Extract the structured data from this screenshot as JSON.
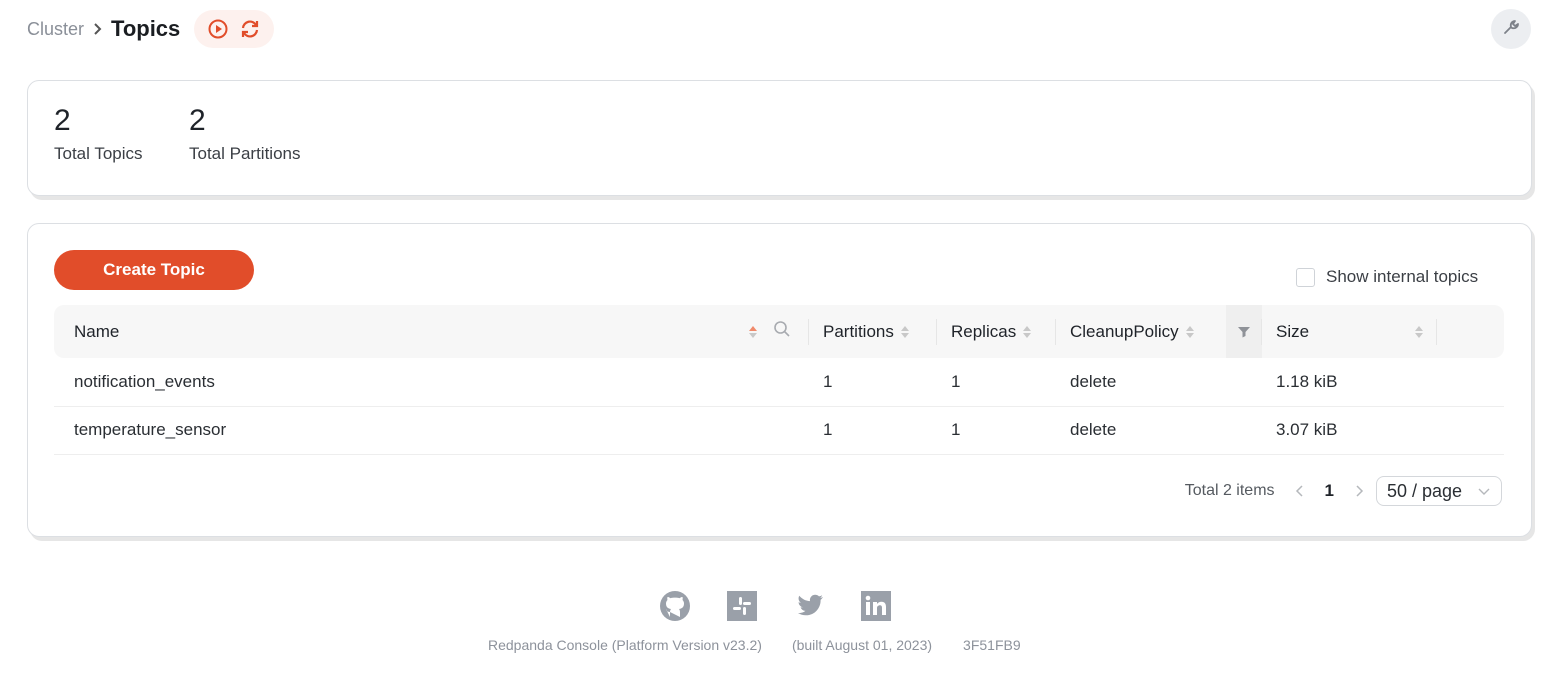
{
  "header": {
    "breadcrumb_parent": "Cluster",
    "title": "Topics",
    "actions": [
      {
        "name": "play-icon"
      },
      {
        "name": "refresh-icon"
      }
    ],
    "settings_icon": "wrench-icon",
    "accent_color": "#e14d2a"
  },
  "stats": [
    {
      "value": "2",
      "label": "Total Topics"
    },
    {
      "value": "2",
      "label": "Total Partitions"
    }
  ],
  "toolbar": {
    "create_label": "Create Topic",
    "show_internal_label": "Show internal topics",
    "show_internal_checked": false
  },
  "table": {
    "columns": [
      "Name",
      "Partitions",
      "Replicas",
      "CleanupPolicy",
      "Size"
    ],
    "rows": [
      {
        "name": "notification_events",
        "partitions": "1",
        "replicas": "1",
        "cleanup": "delete",
        "size": "1.18 kiB"
      },
      {
        "name": "temperature_sensor",
        "partitions": "1",
        "replicas": "1",
        "cleanup": "delete",
        "size": "3.07 kiB"
      }
    ]
  },
  "pagination": {
    "total": "Total 2 items",
    "current_page": "1",
    "page_size": "50 / page"
  },
  "footer": {
    "icons": [
      "github-icon",
      "slack-icon",
      "twitter-icon",
      "linkedin-icon"
    ],
    "version": "Redpanda Console (Platform Version v23.2)",
    "built": "(built August 01, 2023)",
    "commit": "3F51FB9"
  }
}
